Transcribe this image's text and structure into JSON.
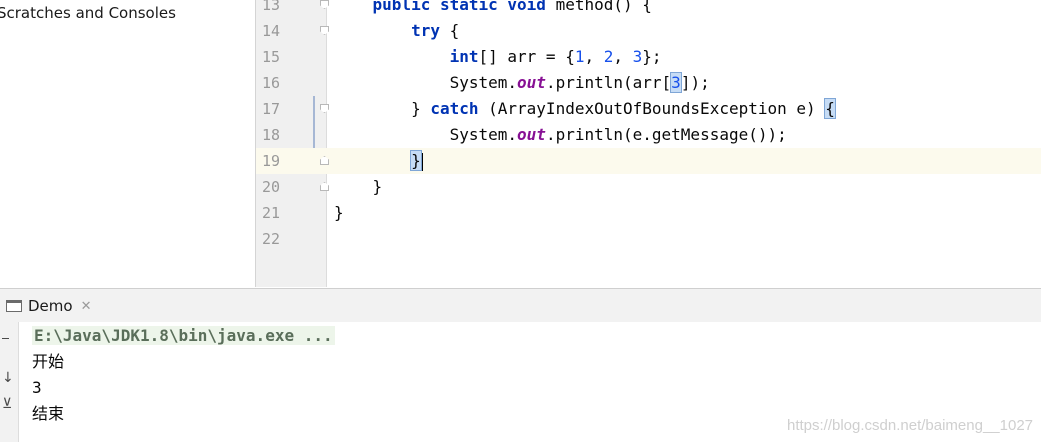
{
  "sidebar": {
    "items": [
      {
        "label": "Scratches and Consoles"
      }
    ]
  },
  "editor": {
    "current_line": 19,
    "lines": [
      {
        "number": "13",
        "tokens": [
          {
            "t": "    "
          },
          {
            "t": "public",
            "c": "kw"
          },
          {
            "t": " "
          },
          {
            "t": "static",
            "c": "kw"
          },
          {
            "t": " "
          },
          {
            "t": "void",
            "c": "kw"
          },
          {
            "t": " method() {"
          }
        ]
      },
      {
        "number": "14",
        "tokens": [
          {
            "t": "        "
          },
          {
            "t": "try",
            "c": "kw"
          },
          {
            "t": " {"
          }
        ]
      },
      {
        "number": "15",
        "tokens": [
          {
            "t": "            "
          },
          {
            "t": "int",
            "c": "kw"
          },
          {
            "t": "[] arr = {"
          },
          {
            "t": "1",
            "c": "num"
          },
          {
            "t": ", "
          },
          {
            "t": "2",
            "c": "num"
          },
          {
            "t": ", "
          },
          {
            "t": "3",
            "c": "num"
          },
          {
            "t": "};"
          }
        ]
      },
      {
        "number": "16",
        "tokens": [
          {
            "t": "            System."
          },
          {
            "t": "out",
            "c": "static"
          },
          {
            "t": ".println(arr["
          },
          {
            "t": "3",
            "c": "num-match"
          },
          {
            "t": "]);"
          }
        ]
      },
      {
        "number": "17",
        "tokens": [
          {
            "t": "        } "
          },
          {
            "t": "catch",
            "c": "kw"
          },
          {
            "t": " (ArrayIndexOutOfBoundsException e) "
          },
          {
            "t": "{",
            "c": "match"
          }
        ]
      },
      {
        "number": "18",
        "tokens": [
          {
            "t": "            System."
          },
          {
            "t": "out",
            "c": "static"
          },
          {
            "t": ".println(e.getMessage());"
          }
        ]
      },
      {
        "number": "19",
        "tokens": [
          {
            "t": "        "
          },
          {
            "t": "}",
            "c": "match"
          },
          {
            "t": "",
            "c": "caret"
          }
        ]
      },
      {
        "number": "20",
        "tokens": [
          {
            "t": "    }"
          }
        ]
      },
      {
        "number": "21",
        "tokens": [
          {
            "t": "}"
          }
        ]
      },
      {
        "number": "22",
        "tokens": []
      }
    ]
  },
  "run": {
    "tab_label": "Demo",
    "close_symbol": "✕",
    "console_lines": [
      {
        "text": "E:\\Java\\JDK1.8\\bin\\java.exe ...",
        "kind": "cmd"
      },
      {
        "text": "开始",
        "kind": "out"
      },
      {
        "text": "3",
        "kind": "out"
      },
      {
        "text": "结束",
        "kind": "out"
      }
    ]
  },
  "watermark": "https://blog.csdn.net/baimeng__1027",
  "colors": {
    "keyword": "#0033b3",
    "number": "#1750eb",
    "static_field": "#871094",
    "current_line_bg": "#fcfaed",
    "brace_match_bg": "#c6dcf5"
  }
}
